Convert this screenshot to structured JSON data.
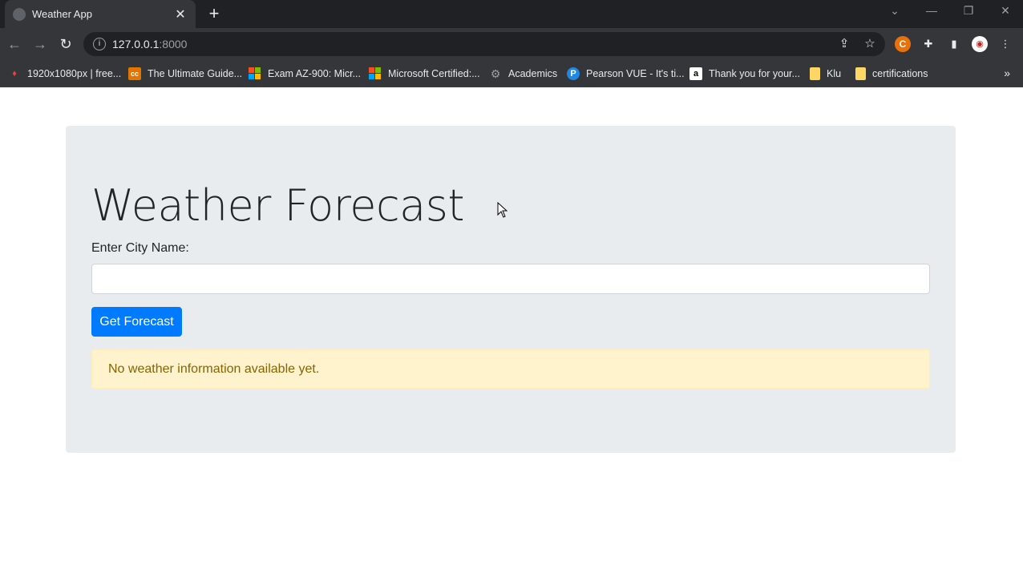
{
  "browser": {
    "tab": {
      "title": "Weather App",
      "close": "✕"
    },
    "new_tab": "+",
    "url_host": "127.0.0.1",
    "url_port": ":8000",
    "bookmarks": [
      {
        "label": "1920x1080px | free...",
        "icon": "flame-icon"
      },
      {
        "label": "The Ultimate Guide...",
        "icon": "cc-icon"
      },
      {
        "label": "Exam AZ-900: Micr...",
        "icon": "microsoft-icon"
      },
      {
        "label": "Microsoft Certified:...",
        "icon": "microsoft-icon"
      },
      {
        "label": "Academics",
        "icon": "gear-icon"
      },
      {
        "label": "Pearson VUE - It's ti...",
        "icon": "pearson-icon"
      },
      {
        "label": "Thank you for your...",
        "icon": "amazon-icon"
      },
      {
        "label": "Klu",
        "icon": "folder-icon"
      },
      {
        "label": "certifications",
        "icon": "folder-icon"
      }
    ],
    "more": "»"
  },
  "page": {
    "title": "Weather Forecast",
    "city_label": "Enter City Name:",
    "city_value": "",
    "submit_label": "Get Forecast",
    "alert_text": "No weather information available yet."
  },
  "colors": {
    "primary": "#007bff",
    "jumbotron": "#e9ecef",
    "alert_bg": "#fff3cd",
    "alert_text": "#856404"
  }
}
